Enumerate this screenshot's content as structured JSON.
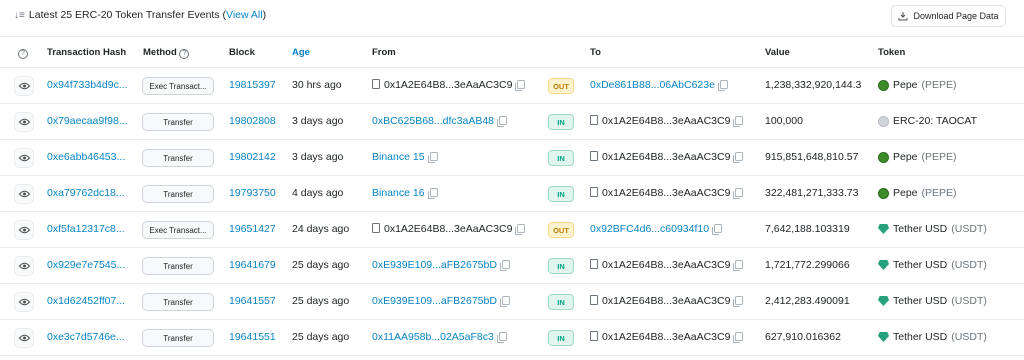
{
  "header": {
    "title_prefix": "Latest 25 ERC-20 Token Transfer Events (",
    "view_all": "View All",
    "title_suffix": ")",
    "download_label": "Download Page Data"
  },
  "columns": {
    "hash": "Transaction Hash",
    "method": "Method",
    "block": "Block",
    "age": "Age",
    "from": "From",
    "to": "To",
    "value": "Value",
    "token": "Token"
  },
  "rows": [
    {
      "hash": "0x94f733b4d9c...",
      "method": "Exec Transact...",
      "block": "19815397",
      "age": "30 hrs ago",
      "from": "0x1A2E64B8...3eAaAC3C9",
      "from_contract": true,
      "from_link": false,
      "dir": "OUT",
      "to": "0xDe861B88...06AbC623e",
      "to_contract": false,
      "to_link": true,
      "value": "1,238,332,920,144.3",
      "token_name": "Pepe",
      "token_sub": "(PEPE)",
      "token_icon": "pepe-icon"
    },
    {
      "hash": "0x79aecaa9f98...",
      "method": "Transfer",
      "block": "19802808",
      "age": "3 days ago",
      "from": "0xBC625B68...dfc3aAB48",
      "from_contract": false,
      "from_link": true,
      "dir": "IN",
      "to": "0x1A2E64B8...3eAaAC3C9",
      "to_contract": true,
      "to_link": false,
      "value": "100,000",
      "token_name": "ERC-20: TAOCAT",
      "token_sub": "",
      "token_icon": "taocat-icon"
    },
    {
      "hash": "0xe6abb46453...",
      "method": "Transfer",
      "block": "19802142",
      "age": "3 days ago",
      "from": "Binance 15",
      "from_contract": false,
      "from_link": true,
      "dir": "IN",
      "to": "0x1A2E64B8...3eAaAC3C9",
      "to_contract": true,
      "to_link": false,
      "value": "915,851,648,810.57",
      "token_name": "Pepe",
      "token_sub": "(PEPE)",
      "token_icon": "pepe-icon"
    },
    {
      "hash": "0xa79762dc18...",
      "method": "Transfer",
      "block": "19793750",
      "age": "4 days ago",
      "from": "Binance 16",
      "from_contract": false,
      "from_link": true,
      "dir": "IN",
      "to": "0x1A2E64B8...3eAaAC3C9",
      "to_contract": true,
      "to_link": false,
      "value": "322,481,271,333.73",
      "token_name": "Pepe",
      "token_sub": "(PEPE)",
      "token_icon": "pepe-icon"
    },
    {
      "hash": "0xf5fa12317c8...",
      "method": "Exec Transact...",
      "block": "19651427",
      "age": "24 days ago",
      "from": "0x1A2E64B8...3eAaAC3C9",
      "from_contract": true,
      "from_link": false,
      "dir": "OUT",
      "to": "0x92BFC4d6...c60934f10",
      "to_contract": false,
      "to_link": true,
      "value": "7,642,188.103319",
      "token_name": "Tether USD",
      "token_sub": "(USDT)",
      "token_icon": "tether-icon"
    },
    {
      "hash": "0x929e7e7545...",
      "method": "Transfer",
      "block": "19641679",
      "age": "25 days ago",
      "from": "0xE939E109...aFB2675bD",
      "from_contract": false,
      "from_link": true,
      "dir": "IN",
      "to": "0x1A2E64B8...3eAaAC3C9",
      "to_contract": true,
      "to_link": false,
      "value": "1,721,772.299066",
      "token_name": "Tether USD",
      "token_sub": "(USDT)",
      "token_icon": "tether-icon"
    },
    {
      "hash": "0x1d62452ff07...",
      "method": "Transfer",
      "block": "19641557",
      "age": "25 days ago",
      "from": "0xE939E109...aFB2675bD",
      "from_contract": false,
      "from_link": true,
      "dir": "IN",
      "to": "0x1A2E64B8...3eAaAC3C9",
      "to_contract": true,
      "to_link": false,
      "value": "2,412,283.490091",
      "token_name": "Tether USD",
      "token_sub": "(USDT)",
      "token_icon": "tether-icon"
    },
    {
      "hash": "0xe3c7d5746e...",
      "method": "Transfer",
      "block": "19641551",
      "age": "25 days ago",
      "from": "0x11AA958b...02A5aF8c3",
      "from_contract": false,
      "from_link": true,
      "dir": "IN",
      "to": "0x1A2E64B8...3eAaAC3C9",
      "to_contract": true,
      "to_link": false,
      "value": "627,910.016362",
      "token_name": "Tether USD",
      "token_sub": "(USDT)",
      "token_icon": "tether-icon"
    }
  ],
  "colors": {
    "link": "#0784c3",
    "out_badge": "#b47d00",
    "in_badge": "#00a186",
    "pepe": "#3d8b2a",
    "tether": "#26a17b"
  }
}
